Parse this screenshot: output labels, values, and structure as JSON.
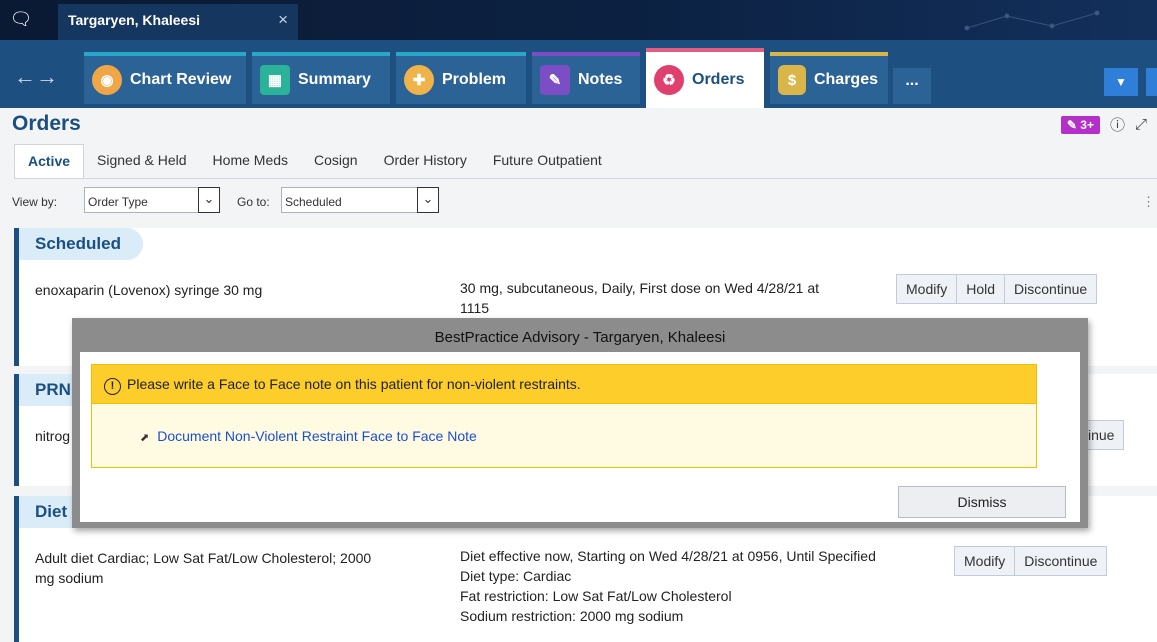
{
  "patient_tab": {
    "name": "Targaryen, Khaleesi",
    "close": "×"
  },
  "activity_tabs": [
    {
      "label": "Chart Review",
      "icon": "chart-review-icon"
    },
    {
      "label": "Summary",
      "icon": "summary-icon"
    },
    {
      "label": "Problem",
      "icon": "problem-icon"
    },
    {
      "label": "Notes",
      "icon": "notes-icon"
    },
    {
      "label": "Orders",
      "icon": "orders-icon",
      "active": true
    },
    {
      "label": "Charges",
      "icon": "charges-icon"
    }
  ],
  "more_tabs": "...",
  "header": {
    "title": "Orders",
    "badge": "3+",
    "help": "?"
  },
  "subtabs": [
    "Active",
    "Signed & Held",
    "Home Meds",
    "Cosign",
    "Order History",
    "Future Outpatient"
  ],
  "filters": {
    "view_by_label": "View by:",
    "view_by_value": "Order Type",
    "go_to_label": "Go to:",
    "go_to_value": "Scheduled"
  },
  "sections": {
    "scheduled": {
      "title": "Scheduled",
      "order": "enoxaparin (Lovenox) syringe 30 mg",
      "details": [
        "30 mg, subcutaneous, Daily, First dose on Wed 4/28/21 at",
        "1115"
      ],
      "buttons": [
        "Modify",
        "Hold",
        "Discontinue"
      ]
    },
    "prn": {
      "title": "PRN",
      "order": "nitrog",
      "button_partial": "inue"
    },
    "diet": {
      "title": "Diet",
      "order": [
        "Adult diet Cardiac; Low Sat Fat/Low Cholesterol; 2000",
        "mg sodium"
      ],
      "details": [
        "Diet effective now, Starting on Wed 4/28/21 at 0956, Until Specified",
        "Diet type: Cardiac",
        "Fat restriction: Low Sat Fat/Low Cholesterol",
        "Sodium restriction: 2000 mg sodium"
      ],
      "buttons": [
        "Modify",
        "Discontinue"
      ]
    }
  },
  "modal": {
    "title": "BestPractice Advisory - Targaryen, Khaleesi",
    "warning_icon": "!",
    "message": "Please write a Face to Face note on this patient for non-violent restraints.",
    "link": "Document Non-Violent Restraint Face to Face Note",
    "dismiss": "Dismiss"
  },
  "colors": {
    "title_bar": "#0b1a33",
    "activity_bar": "#1d4f80",
    "accent_blue": "#1b4f82",
    "advisory_yellow": "#fccd2b",
    "link_blue": "#1a4fd4"
  }
}
